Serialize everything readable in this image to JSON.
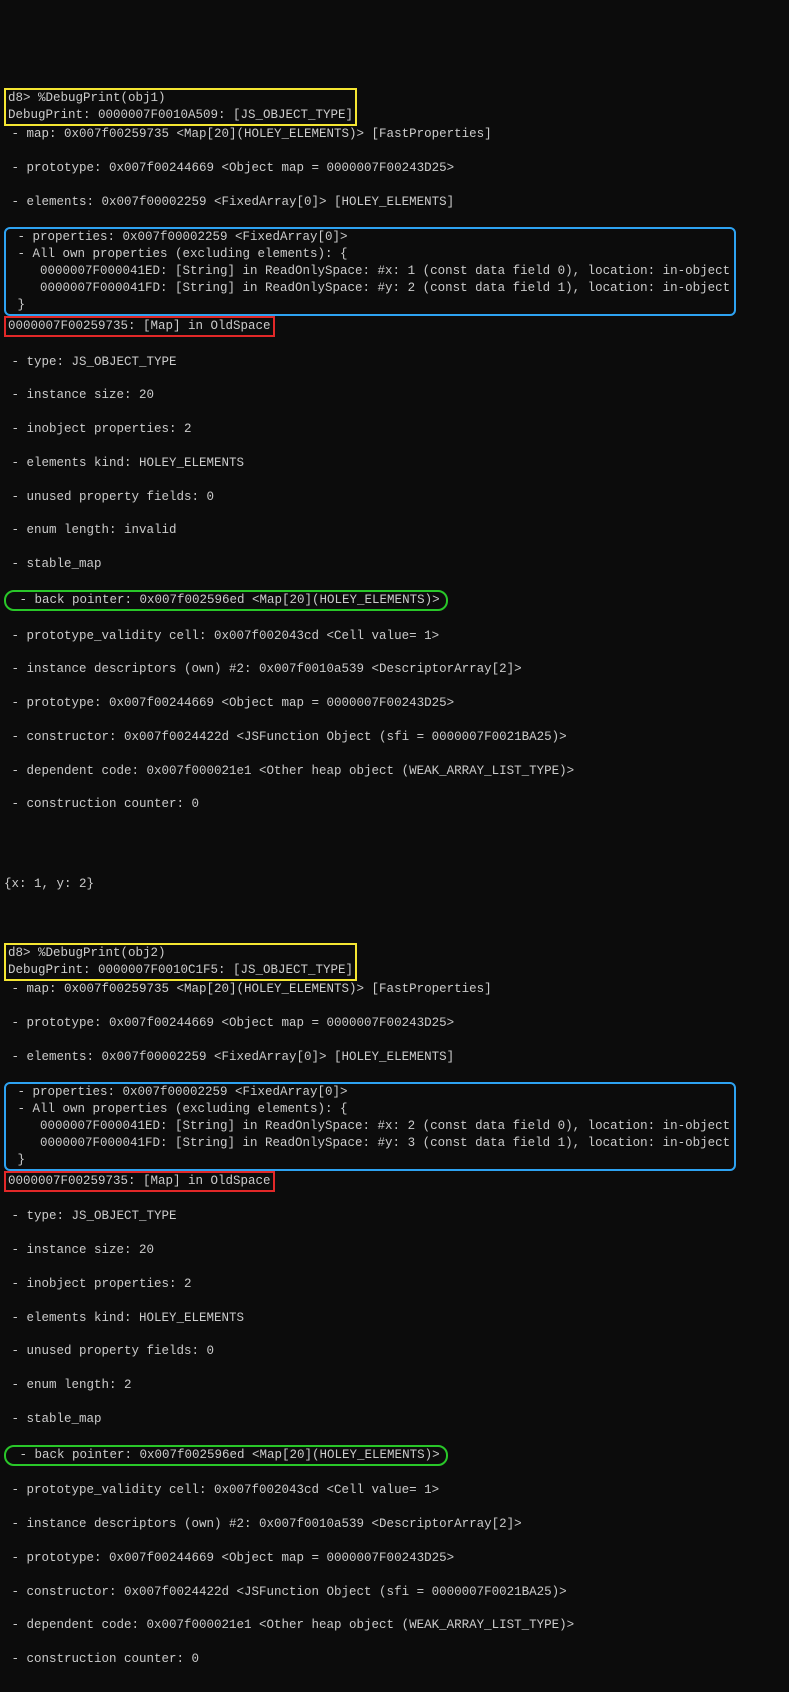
{
  "obj1": {
    "cmd": "d8> %DebugPrint(obj1)",
    "debugprint": "DebugPrint: 0000007F0010A509: [JS_OBJECT_TYPE]",
    "map": " - map: 0x007f00259735 <Map[20](HOLEY_ELEMENTS)> [FastProperties]",
    "prototype": " - prototype: 0x007f00244669 <Object map = 0000007F00243D25>",
    "elements": " - elements: 0x007f00002259 <FixedArray[0]> [HOLEY_ELEMENTS]",
    "props_block": " - properties: 0x007f00002259 <FixedArray[0]>\n - All own properties (excluding elements): {\n    0000007F000041ED: [String] in ReadOnlySpace: #x: 1 (const data field 0), location: in-object\n    0000007F000041FD: [String] in ReadOnlySpace: #y: 2 (const data field 1), location: in-object\n }",
    "map_header": "0000007F00259735: [Map] in OldSpace",
    "m01": " - type: JS_OBJECT_TYPE",
    "m02": " - instance size: 20",
    "m03": " - inobject properties: 2",
    "m04": " - elements kind: HOLEY_ELEMENTS",
    "m05": " - unused property fields: 0",
    "m06": " - enum length: invalid",
    "m07": " - stable_map",
    "backpointer": " - back pointer: 0x007f002596ed <Map[20](HOLEY_ELEMENTS)>",
    "m08": " - prototype_validity cell: 0x007f002043cd <Cell value= 1>",
    "m09": " - instance descriptors (own) #2: 0x007f0010a539 <DescriptorArray[2]>",
    "m10": " - prototype: 0x007f00244669 <Object map = 0000007F00243D25>",
    "m11": " - constructor: 0x007f0024422d <JSFunction Object (sfi = 0000007F0021BA25)>",
    "m12": " - dependent code: 0x007f000021e1 <Other heap object (WEAK_ARRAY_LIST_TYPE)>",
    "m13": " - construction counter: 0"
  },
  "mid": "{x: 1, y: 2}",
  "obj2": {
    "cmd": "d8> %DebugPrint(obj2)",
    "debugprint": "DebugPrint: 0000007F0010C1F5: [JS_OBJECT_TYPE]",
    "map": " - map: 0x007f00259735 <Map[20](HOLEY_ELEMENTS)> [FastProperties]",
    "prototype": " - prototype: 0x007f00244669 <Object map = 0000007F00243D25>",
    "elements": " - elements: 0x007f00002259 <FixedArray[0]> [HOLEY_ELEMENTS]",
    "props_block": " - properties: 0x007f00002259 <FixedArray[0]>\n - All own properties (excluding elements): {\n    0000007F000041ED: [String] in ReadOnlySpace: #x: 2 (const data field 0), location: in-object\n    0000007F000041FD: [String] in ReadOnlySpace: #y: 3 (const data field 1), location: in-object\n }",
    "map_header": "0000007F00259735: [Map] in OldSpace",
    "m01": " - type: JS_OBJECT_TYPE",
    "m02": " - instance size: 20",
    "m03": " - inobject properties: 2",
    "m04": " - elements kind: HOLEY_ELEMENTS",
    "m05": " - unused property fields: 0",
    "m06": " - enum length: 2",
    "m07": " - stable_map",
    "backpointer": " - back pointer: 0x007f002596ed <Map[20](HOLEY_ELEMENTS)>",
    "m08": " - prototype_validity cell: 0x007f002043cd <Cell value= 1>",
    "m09": " - instance descriptors (own) #2: 0x007f0010a539 <DescriptorArray[2]>",
    "m10": " - prototype: 0x007f00244669 <Object map = 0000007F00243D25>",
    "m11": " - constructor: 0x007f0024422d <JSFunction Object (sfi = 0000007F0021BA25)>",
    "m12": " - dependent code: 0x007f000021e1 <Other heap object (WEAK_ARRAY_LIST_TYPE)>",
    "m13": " - construction counter: 0"
  }
}
